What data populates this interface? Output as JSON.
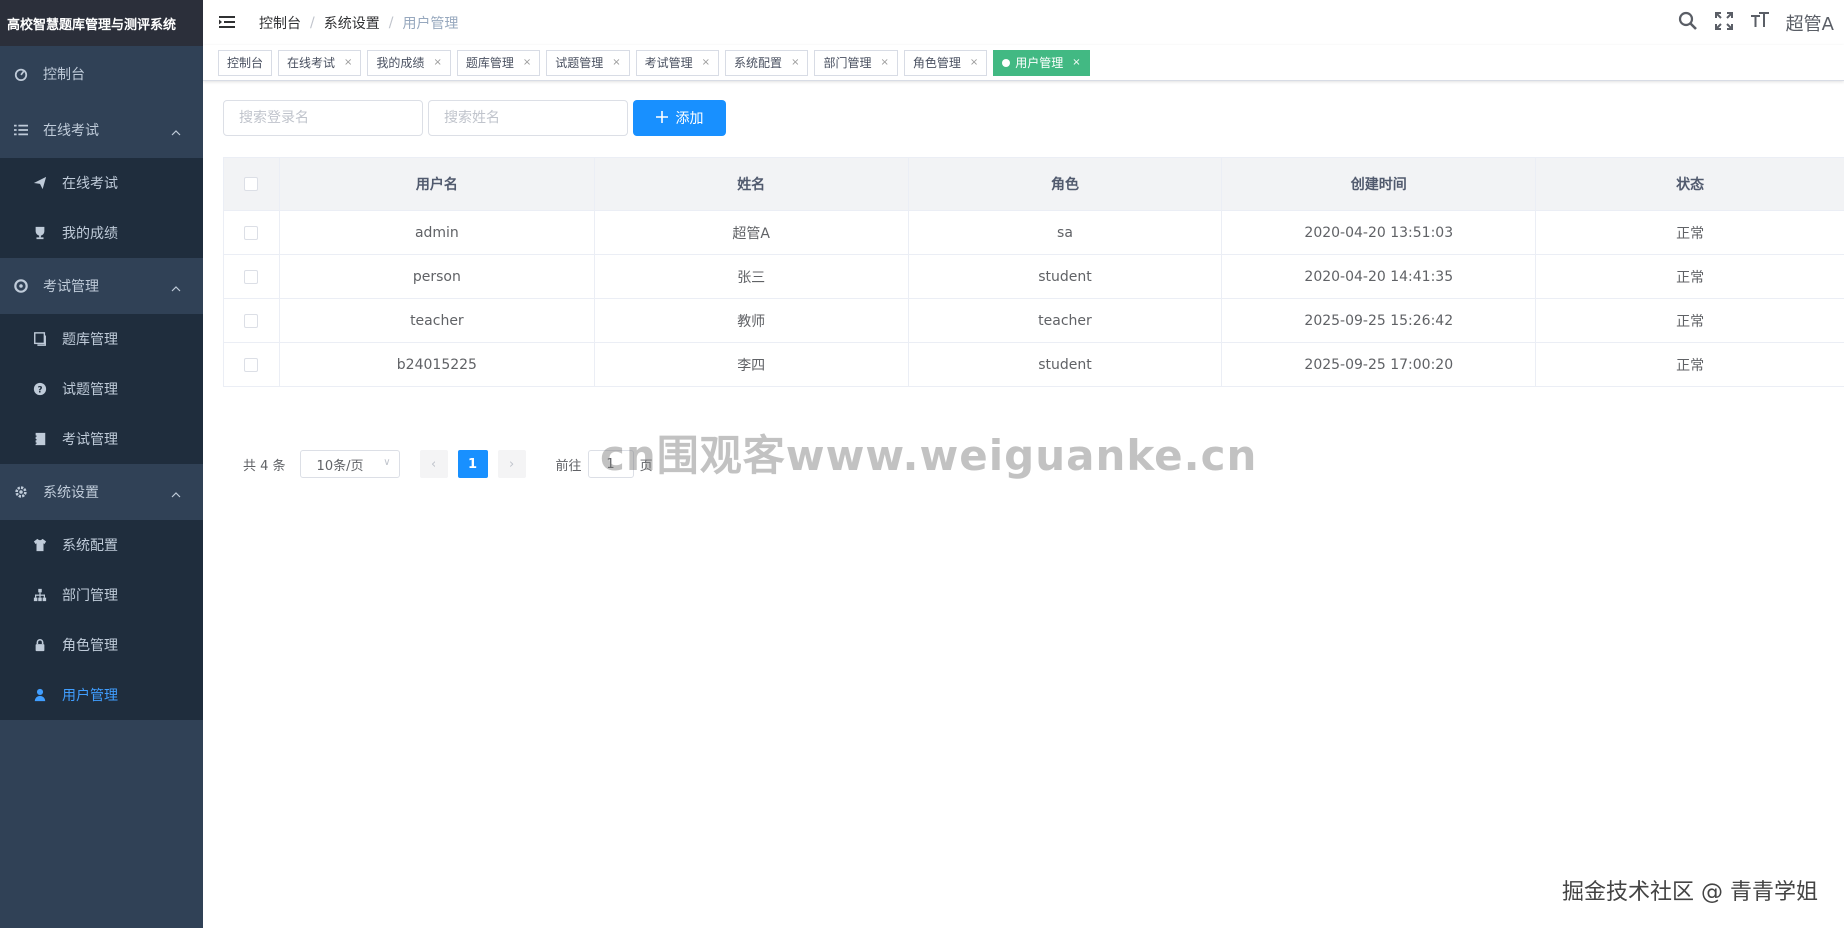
{
  "app": {
    "title": "高校智慧题库管理与测评系统"
  },
  "sidebar": {
    "dashboard": "控制台",
    "groups": [
      {
        "label": "在线考试",
        "items": [
          "在线考试",
          "我的成绩"
        ]
      },
      {
        "label": "考试管理",
        "items": [
          "题库管理",
          "试题管理",
          "考试管理"
        ]
      },
      {
        "label": "系统设置",
        "items": [
          "系统配置",
          "部门管理",
          "角色管理",
          "用户管理"
        ]
      }
    ],
    "active_item": "用户管理"
  },
  "breadcrumb": [
    "控制台",
    "系统设置",
    "用户管理"
  ],
  "header": {
    "user": "超管A"
  },
  "tags": [
    "控制台",
    "在线考试",
    "我的成绩",
    "题库管理",
    "试题管理",
    "考试管理",
    "系统配置",
    "部门管理",
    "角色管理",
    "用户管理"
  ],
  "filters": {
    "login_placeholder": "搜索登录名",
    "name_placeholder": "搜索姓名",
    "add_label": "添加"
  },
  "table": {
    "columns": [
      "用户名",
      "姓名",
      "角色",
      "创建时间",
      "状态"
    ],
    "rows": [
      [
        "admin",
        "超管A",
        "sa",
        "2020-04-20 13:51:03",
        "正常"
      ],
      [
        "person",
        "张三",
        "student",
        "2020-04-20 14:41:35",
        "正常"
      ],
      [
        "teacher",
        "教师",
        "teacher",
        "2025-09-25 15:26:42",
        "正常"
      ],
      [
        "b24015225",
        "李四",
        "student",
        "2025-09-25 17:00:20",
        "正常"
      ]
    ]
  },
  "pagination": {
    "total": "共 4 条",
    "page_size": "10条/页",
    "current": "1",
    "goto_prefix": "前往",
    "goto_value": "1",
    "goto_suffix": "页"
  },
  "watermark": "cn围观客www.weiguanke.cn",
  "footer_mark": "掘金技术社区 @ 青青学姐",
  "colors": {
    "sidebar": "#304156",
    "active": "#409eff",
    "primary": "#1890ff",
    "tag_active": "#42b983"
  }
}
